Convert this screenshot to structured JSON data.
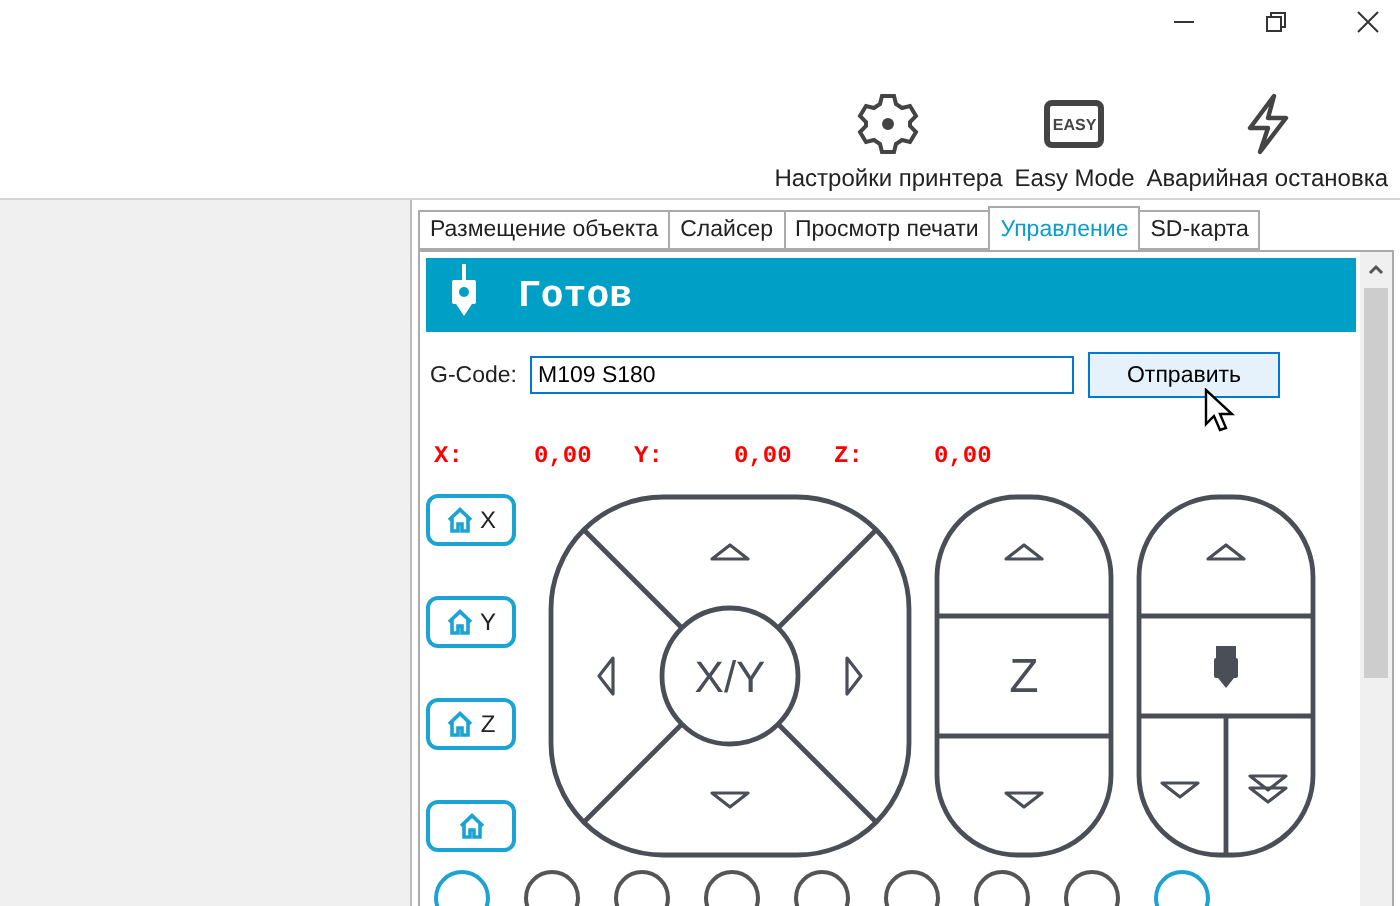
{
  "toolbar": [
    {
      "kind": "gear",
      "label": "Настройки принтера"
    },
    {
      "kind": "easy",
      "label": "Easy Mode",
      "badge": "EASY"
    },
    {
      "kind": "bolt",
      "label": "Аварийная остановка"
    }
  ],
  "tabs": [
    {
      "label": "Размещение объекта",
      "selected": false
    },
    {
      "label": "Слайсер",
      "selected": false
    },
    {
      "label": "Просмотр печати",
      "selected": false
    },
    {
      "label": "Управление",
      "selected": true
    },
    {
      "label": "SD-карта",
      "selected": false
    }
  ],
  "status": "Готов",
  "gcode": {
    "label": "G-Code:",
    "value": "M109 S180",
    "button": "Отправить"
  },
  "coordinates": [
    {
      "axis": "X:",
      "value": "0,00"
    },
    {
      "axis": "Y:",
      "value": "0,00"
    },
    {
      "axis": "Z:",
      "value": "0,00"
    }
  ],
  "home_buttons": [
    {
      "kind": "axis",
      "label": "X"
    },
    {
      "kind": "axis",
      "label": "Y"
    },
    {
      "kind": "axis",
      "label": "Z"
    },
    {
      "kind": "all"
    }
  ],
  "xy_pad": {
    "label": "X/Y"
  },
  "z_pad": {
    "label": "Z"
  },
  "bottom_buttons": [
    {
      "active": true
    },
    {
      "active": false
    },
    {
      "active": false
    },
    {
      "active": false
    },
    {
      "active": false
    },
    {
      "active": false
    },
    {
      "active": false
    },
    {
      "active": false
    },
    {
      "active": true
    }
  ]
}
